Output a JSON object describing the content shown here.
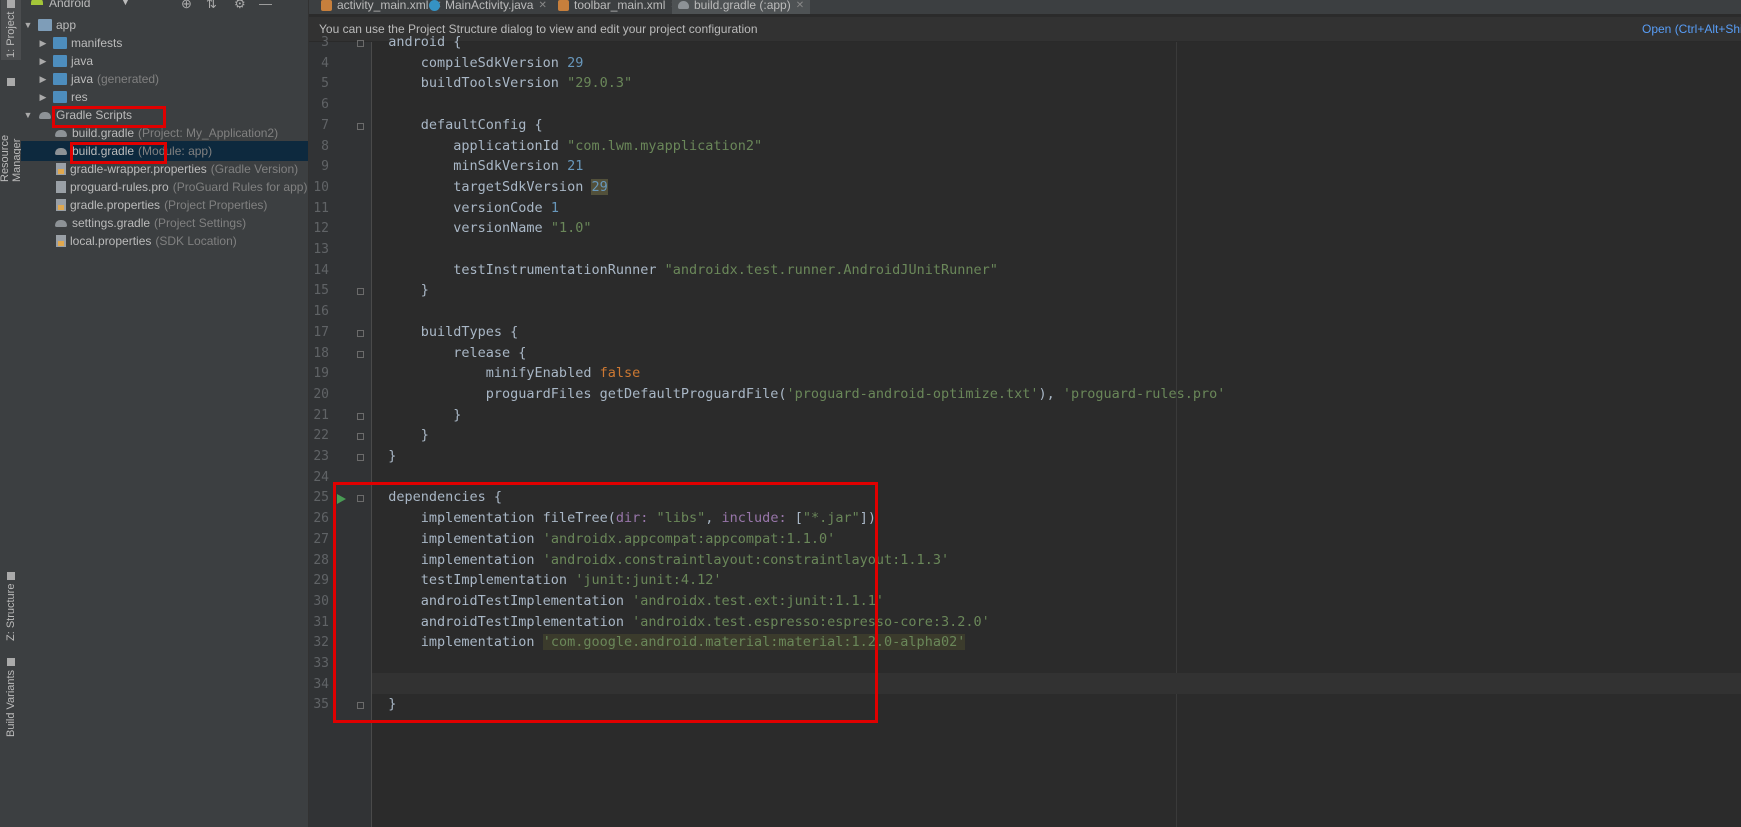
{
  "left_strip": {
    "project_tab": "1: Project",
    "resource_manager_tab": "Resource Manager",
    "structure_tab": "Z: Structure",
    "build_variants_tab": "Build Variants"
  },
  "project_panel": {
    "view_mode": "Android",
    "tree": [
      {
        "label": "app",
        "hint": ""
      },
      {
        "label": "manifests",
        "hint": ""
      },
      {
        "label": "java",
        "hint": ""
      },
      {
        "label": "java",
        "hint": "(generated)"
      },
      {
        "label": "res",
        "hint": ""
      },
      {
        "label": "Gradle Scripts",
        "hint": ""
      },
      {
        "label": "build.gradle",
        "hint": "(Project: My_Application2)"
      },
      {
        "label": "build.gradle",
        "hint": "(Module: app)"
      },
      {
        "label": "gradle-wrapper.properties",
        "hint": "(Gradle Version)"
      },
      {
        "label": "proguard-rules.pro",
        "hint": "(ProGuard Rules for app)"
      },
      {
        "label": "gradle.properties",
        "hint": "(Project Properties)"
      },
      {
        "label": "settings.gradle",
        "hint": "(Project Settings)"
      },
      {
        "label": "local.properties",
        "hint": "(SDK Location)"
      }
    ]
  },
  "editor_tabs": [
    {
      "label": "activity_main.xml",
      "icon": "xml-file-icon"
    },
    {
      "label": "MainActivity.java",
      "icon": "java-class-icon"
    },
    {
      "label": "toolbar_main.xml",
      "icon": "xml-file-icon"
    },
    {
      "label": "build.gradle (:app)",
      "icon": "gradle-icon",
      "active": true
    }
  ],
  "notification": {
    "message": "You can use the Project Structure dialog to view and edit your project configuration",
    "action": "Open (Ctrl+Alt+Shift+S)"
  },
  "code_lines": [
    {
      "n": "3",
      "text": "android {"
    },
    {
      "n": "4",
      "text": "    compileSdkVersion 29"
    },
    {
      "n": "5",
      "text": "    buildToolsVersion \"29.0.3\""
    },
    {
      "n": "6",
      "text": ""
    },
    {
      "n": "7",
      "text": "    defaultConfig {"
    },
    {
      "n": "8",
      "text": "        applicationId \"com.lwm.myapplication2\""
    },
    {
      "n": "9",
      "text": "        minSdkVersion 21"
    },
    {
      "n": "10",
      "text": "        targetSdkVersion 29"
    },
    {
      "n": "11",
      "text": "        versionCode 1"
    },
    {
      "n": "12",
      "text": "        versionName \"1.0\""
    },
    {
      "n": "13",
      "text": ""
    },
    {
      "n": "14",
      "text": "        testInstrumentationRunner \"androidx.test.runner.AndroidJUnitRunner\""
    },
    {
      "n": "15",
      "text": "    }"
    },
    {
      "n": "16",
      "text": ""
    },
    {
      "n": "17",
      "text": "    buildTypes {"
    },
    {
      "n": "18",
      "text": "        release {"
    },
    {
      "n": "19",
      "text": "            minifyEnabled false"
    },
    {
      "n": "20",
      "text": "            proguardFiles getDefaultProguardFile('proguard-android-optimize.txt'), 'proguard-rules.pro'"
    },
    {
      "n": "21",
      "text": "        }"
    },
    {
      "n": "22",
      "text": "    }"
    },
    {
      "n": "23",
      "text": "}"
    },
    {
      "n": "24",
      "text": ""
    },
    {
      "n": "25",
      "text": "dependencies {"
    },
    {
      "n": "26",
      "text": "    implementation fileTree(dir: \"libs\", include: [\"*.jar\"])"
    },
    {
      "n": "27",
      "text": "    implementation 'androidx.appcompat:appcompat:1.1.0'"
    },
    {
      "n": "28",
      "text": "    implementation 'androidx.constraintlayout:constraintlayout:1.1.3'"
    },
    {
      "n": "29",
      "text": "    testImplementation 'junit:junit:4.12'"
    },
    {
      "n": "30",
      "text": "    androidTestImplementation 'androidx.test.ext:junit:1.1.1'"
    },
    {
      "n": "31",
      "text": "    androidTestImplementation 'androidx.test.espresso:espresso-core:3.2.0'"
    },
    {
      "n": "32",
      "text": "    implementation 'com.google.android.material:material:1.2.0-alpha02'"
    },
    {
      "n": "33",
      "text": ""
    },
    {
      "n": "34",
      "text": ""
    },
    {
      "n": "35",
      "text": "}"
    }
  ],
  "colors": {
    "background": "#2b2b2b",
    "panel": "#3c3f41",
    "string": "#6a8759",
    "number": "#6897bb",
    "keyword": "#cc7832",
    "named_arg": "#9876aa",
    "link": "#589df6",
    "annotation_box": "#e00000"
  }
}
